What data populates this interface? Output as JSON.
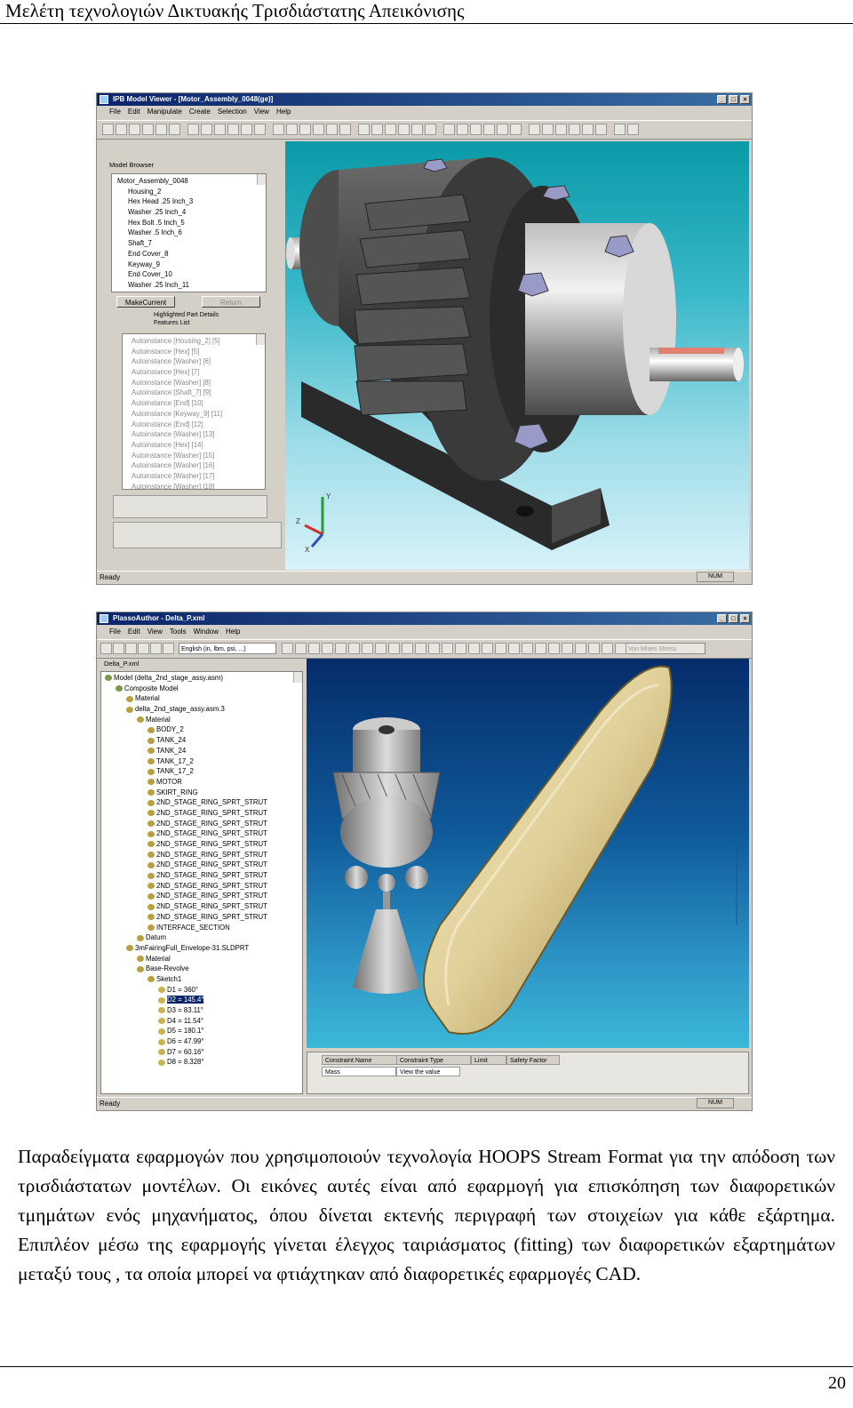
{
  "header": {
    "title": "Μελέτη τεχνολογιών Δικτυακής Τρισδιάστατης Απεικόνισης"
  },
  "screenshot1": {
    "window_title": "IPB Model Viewer - [Motor_Assembly_0048(ge)]",
    "menu": [
      "File",
      "Edit",
      "Manipulate",
      "Create",
      "Selection",
      "View",
      "Help"
    ],
    "model_browser_label": "Model Browser",
    "tree_items": [
      "Motor_Assembly_0048",
      "Housing_2",
      "Hex Head .25 Inch_3",
      "Washer .25 Inch_4",
      "Hex Bolt .5 Inch_5",
      "Washer .5 Inch_6",
      "Shaft_7",
      "End Cover_8",
      "Keyway_9",
      "End Cover_10",
      "Washer .25 Inch_11"
    ],
    "make_current_label": "MakeCurrent",
    "return_label": "Return",
    "highlighted_label": "Highlighted Part Details",
    "features_label": "Features List",
    "features": [
      "Autoinstance [Housing_2] [5]",
      "Autoinstance [Hex] [5]",
      "Autoinstance [Washer] [6]",
      "Autoinstance [Hex] [7]",
      "Autoinstance [Washer] [8]",
      "Autoinstance [Shaft_7] [9]",
      "Autoinstance [End] [10]",
      "Autoinstance [Keyway_9] [11]",
      "Autoinstance [End] [12]",
      "Autoinstance [Washer] [13]",
      "Autoinstance [Hex] [14]",
      "Autoinstance [Washer] [15]",
      "Autoinstance [Washer] [16]",
      "Autoinstance [Washer] [17]",
      "Autoinstance [Washer] [18]"
    ],
    "status_left": "Ready",
    "status_right": "NUM",
    "axis_y": "Y",
    "axis_z": "Z",
    "axis_x": "X"
  },
  "screenshot2": {
    "window_title": "PlassoAuthor - Delta_P.xml",
    "menu": [
      "File",
      "Edit",
      "View",
      "Tools",
      "Window",
      "Help"
    ],
    "units_select": "English (in, lbm, psi, ...)",
    "tab_label": "Delta_P.xml",
    "tree_items": [
      "Model (delta_2nd_stage_assy.asm)",
      "Composite Model",
      "Material",
      "delta_2nd_stage_assy.asm.3",
      "Material",
      "BODY_2",
      "TANK_24",
      "TANK_24",
      "TANK_17_2",
      "TANK_17_2",
      "MOTOR",
      "SKIRT_RING",
      "2ND_STAGE_RING_SPRT_STRUT",
      "2ND_STAGE_RING_SPRT_STRUT",
      "2ND_STAGE_RING_SPRT_STRUT",
      "2ND_STAGE_RING_SPRT_STRUT",
      "2ND_STAGE_RING_SPRT_STRUT",
      "2ND_STAGE_RING_SPRT_STRUT",
      "2ND_STAGE_RING_SPRT_STRUT",
      "2ND_STAGE_RING_SPRT_STRUT",
      "2ND_STAGE_RING_SPRT_STRUT",
      "2ND_STAGE_RING_SPRT_STRUT",
      "2ND_STAGE_RING_SPRT_STRUT",
      "2ND_STAGE_RING_SPRT_STRUT",
      "INTERFACE_SECTION",
      "Datum",
      "3mFairingFull_Envelope-31.SLDPRT",
      "Material",
      "Base-Revolve",
      "Sketch1",
      "D1 = 360°",
      "D2 = 145.4°",
      "D3 = 83.11°",
      "D4 = 11.54°",
      "D5 = 180.1°",
      "D6 = 47.99°",
      "D7 = 60.16°",
      "D8 = 8.328°"
    ],
    "table_headers": [
      "Constraint Name",
      "Constraint Type",
      "Limit",
      "Safety Factor"
    ],
    "table_row": [
      "Mass",
      "View the value"
    ],
    "toolbar_right": "Von Mises Stress",
    "status_left": "Ready",
    "status_right": "NUM"
  },
  "caption": {
    "text": "Παραδείγματα εφαρμογών που χρησιμοποιούν τεχνολογία HOOPS Stream Format για την απόδοση των τρισδιάστατων μοντέλων. Οι εικόνες αυτές είναι από εφαρμογή για επισκόπηση των διαφορετικών τμημάτων ενός μηχανήματος, όπου δίνεται εκτενής περιγραφή των στοιχείων για κάθε εξάρτημα. Επιπλέον μέσω της εφαρμογής γίνεται έλεγχος ταιριάσματος (fitting) των διαφορετικών εξαρτημάτων μεταξύ τους , τα οποία μπορεί να φτιάχτηκαν από διαφορετικές εφαρμογές CAD."
  },
  "footer": {
    "page_number": "20"
  },
  "colors": {
    "viewport1_top": "#0a9aa8",
    "viewport1_bottom": "#d8f2f8",
    "viewport2_top": "#062c6a",
    "viewport2_bottom": "#3cb8d8",
    "accent_gold": "#e8c860"
  }
}
